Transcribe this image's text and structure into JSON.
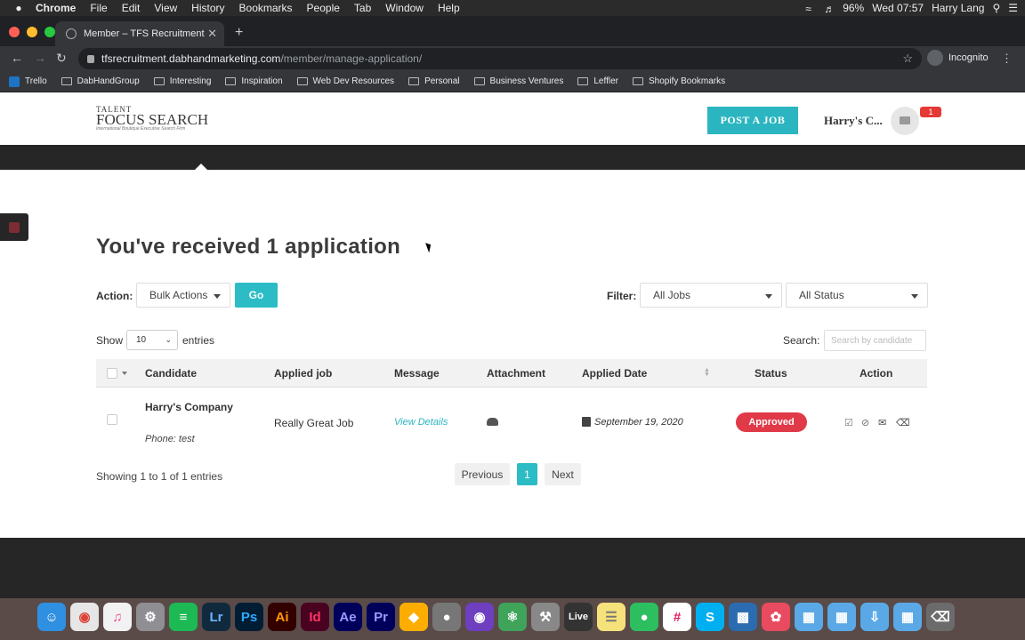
{
  "menubar": {
    "app": "Chrome",
    "items": [
      "File",
      "Edit",
      "View",
      "History",
      "Bookmarks",
      "People",
      "Tab",
      "Window",
      "Help"
    ],
    "battery": "96%",
    "clock": "Wed 07:57",
    "user": "Harry Lang"
  },
  "browser": {
    "tab_title": "Member – TFS Recruitment",
    "url_host": "tfsrecruitment.dabhandmarketing.com",
    "url_path": "/member/manage-application/",
    "profile": "Incognito"
  },
  "bookmarks": [
    "Trello",
    "DabHandGroup",
    "Interesting",
    "Inspiration",
    "Web Dev Resources",
    "Personal",
    "Business Ventures",
    "Leffler",
    "Shopify Bookmarks"
  ],
  "site": {
    "logo_line1": "TALENT",
    "logo_line2": "FOCUS SEARCH",
    "logo_tagline": "International Boutique Executive Search Firm",
    "post_job": "POST A JOB",
    "user_name": "Harry's C...",
    "notification_count": "1"
  },
  "page": {
    "headline": "You've received 1 application",
    "action_label": "Action:",
    "bulk_action": "Bulk Actions",
    "go": "Go",
    "filter_label": "Filter:",
    "filter_jobs": "All Jobs",
    "filter_status": "All Status",
    "show_label": "Show",
    "page_length": "10",
    "entries_label": "entries",
    "search_label": "Search:",
    "search_placeholder": "Search by candidate"
  },
  "table": {
    "columns": [
      "Candidate",
      "Applied job",
      "Message",
      "Attachment",
      "Applied Date",
      "Status",
      "Action"
    ],
    "rows": [
      {
        "candidate": "Harry's Company",
        "phone": "Phone: test",
        "job": "Really Great Job",
        "message": "View Details",
        "date": "September 19, 2020",
        "status": "Approved"
      }
    ]
  },
  "pagination": {
    "info": "Showing 1 to 1 of 1 entries",
    "previous": "Previous",
    "current": "1",
    "next": "Next"
  },
  "colors": {
    "accent": "#2bbcc6",
    "status_approved": "#e03a48",
    "dark_bar": "#262626"
  },
  "dock": [
    "Finder",
    "Chrome",
    "iTunes",
    "System Preferences",
    "Spotify",
    "Lr",
    "Ps",
    "Ai",
    "Id",
    "Ae",
    "Pr",
    "Sketch",
    "TablePlus",
    "GitHub Desktop",
    "Atom",
    "Xcode",
    "Live",
    "Notes",
    "Evernote",
    "Slack",
    "Skype",
    "Activity Monitor",
    "Setapp",
    "Applications",
    "Documents",
    "Downloads",
    "Desktop",
    "Trash"
  ]
}
